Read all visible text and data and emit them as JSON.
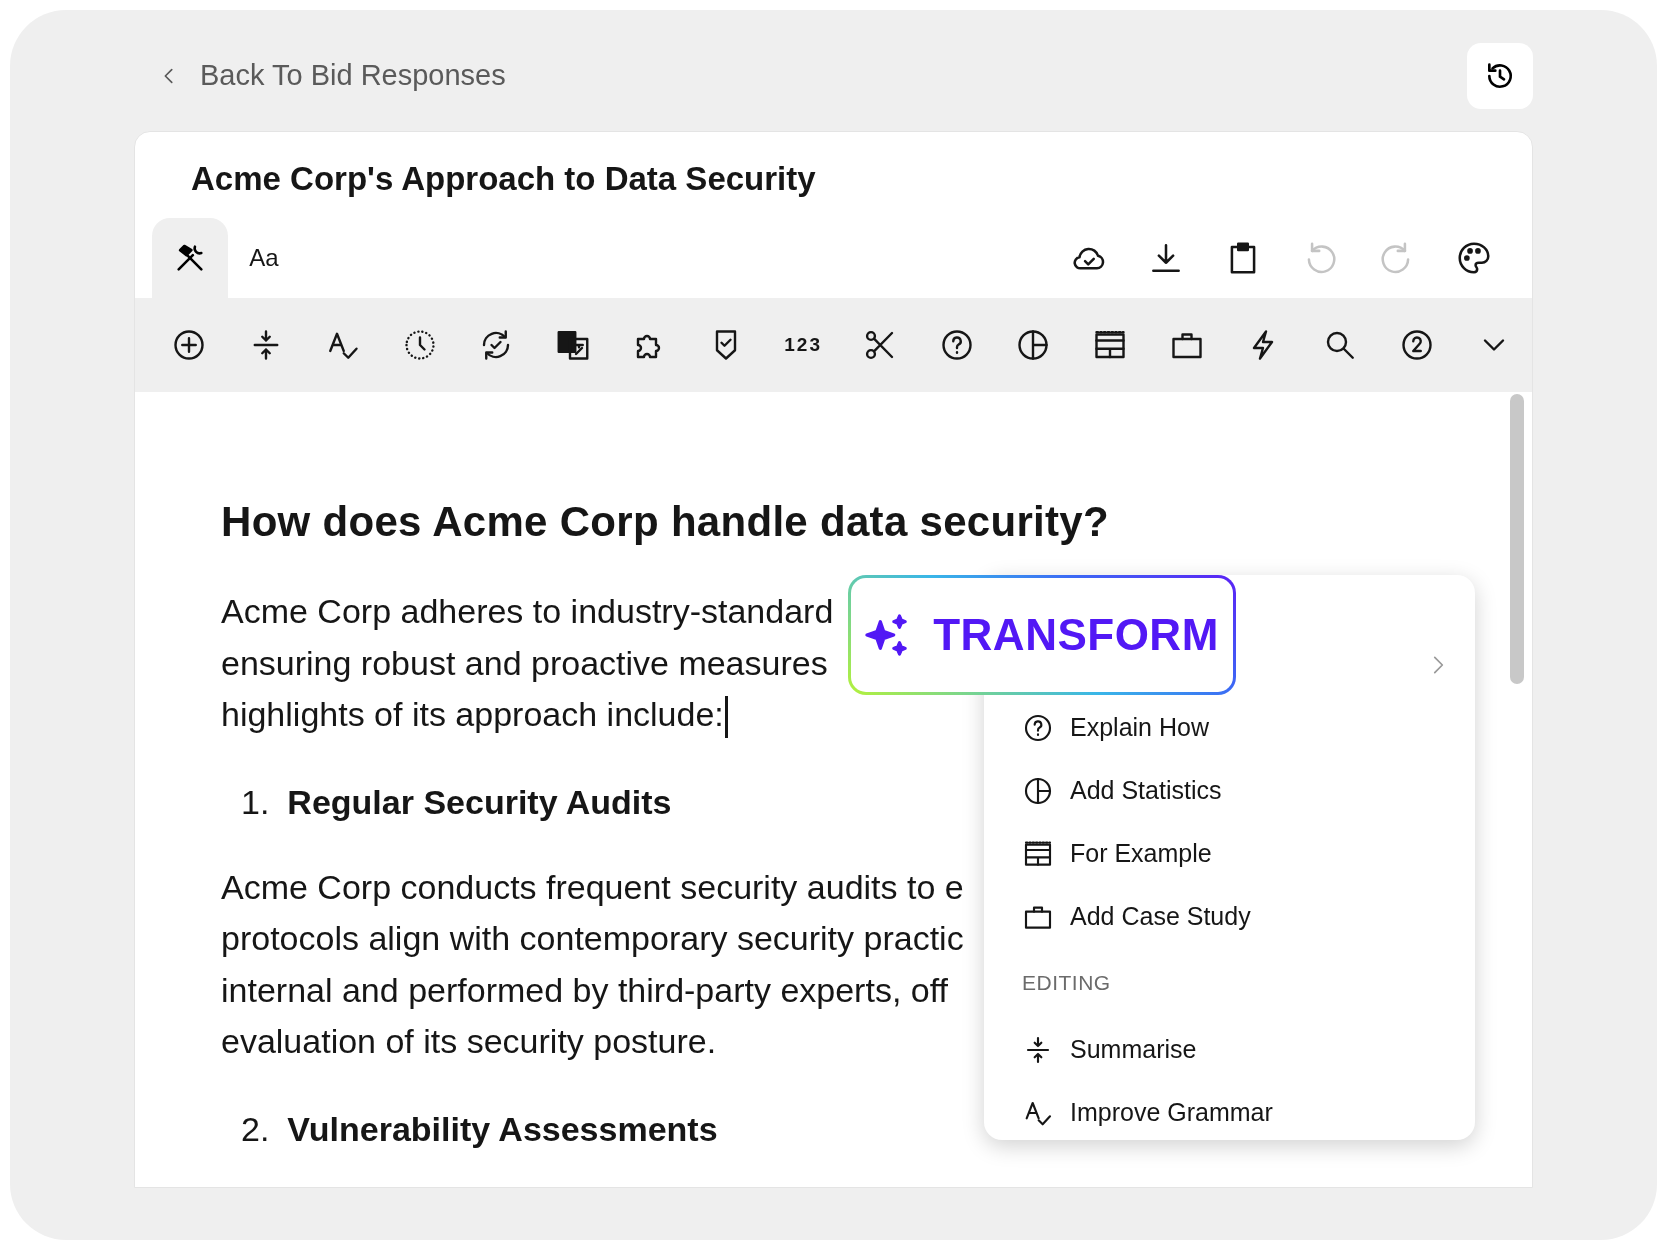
{
  "back_link": {
    "label": "Back To Bid Responses"
  },
  "document": {
    "title": "Acme Corp's Approach to Data Security"
  },
  "tabs": [
    {
      "kind": "tools",
      "selected": true
    },
    {
      "kind": "text",
      "label": "Aa",
      "selected": false
    }
  ],
  "actions": [
    {
      "kind": "cloud",
      "disabled": false
    },
    {
      "kind": "download",
      "disabled": false
    },
    {
      "kind": "clipboard",
      "disabled": false
    },
    {
      "kind": "undo",
      "disabled": true
    },
    {
      "kind": "redo",
      "disabled": true
    },
    {
      "kind": "palette",
      "disabled": false
    }
  ],
  "tools": [
    {
      "kind": "add"
    },
    {
      "kind": "summarise"
    },
    {
      "kind": "grammar"
    },
    {
      "kind": "clock"
    },
    {
      "kind": "sync"
    },
    {
      "kind": "translate"
    },
    {
      "kind": "puzzle"
    },
    {
      "kind": "shield"
    },
    {
      "kind": "numbers",
      "label": "123"
    },
    {
      "kind": "scissors"
    },
    {
      "kind": "explain"
    },
    {
      "kind": "statistics"
    },
    {
      "kind": "example"
    },
    {
      "kind": "case-study"
    },
    {
      "kind": "lightning"
    },
    {
      "kind": "search"
    },
    {
      "kind": "two"
    },
    {
      "kind": "more"
    }
  ],
  "content": {
    "heading": "How does Acme Corp handle data security?",
    "blocks": [
      {
        "kind": "paragraph",
        "lines": [
          "Acme Corp adheres to industry-standard",
          "ensuring robust and proactive measures",
          "highlights of its approach include:"
        ],
        "cursor": true
      },
      {
        "kind": "list-item",
        "number": "1.",
        "text": "Regular Security Audits"
      },
      {
        "kind": "paragraph",
        "lines": [
          "Acme Corp conducts frequent security audits to e",
          "protocols align with contemporary security practic",
          "internal and performed by third-party experts, off",
          "evaluation of its security posture."
        ],
        "cursor": false
      },
      {
        "kind": "list-item",
        "number": "2.",
        "text": "Vulnerability Assessments"
      }
    ]
  },
  "transform": {
    "label": "TRANSFORM"
  },
  "menu": {
    "items": [
      {
        "kind": "submenu"
      },
      {
        "kind": "explain",
        "label": "Explain How"
      },
      {
        "kind": "statistics",
        "label": "Add Statistics"
      },
      {
        "kind": "example",
        "label": "For Example"
      },
      {
        "kind": "case-study",
        "label": "Add Case Study"
      },
      {
        "kind": "header",
        "label": "EDITING"
      },
      {
        "kind": "summarise",
        "label": "Summarise"
      },
      {
        "kind": "grammar",
        "label": "Improve Grammar"
      }
    ]
  }
}
